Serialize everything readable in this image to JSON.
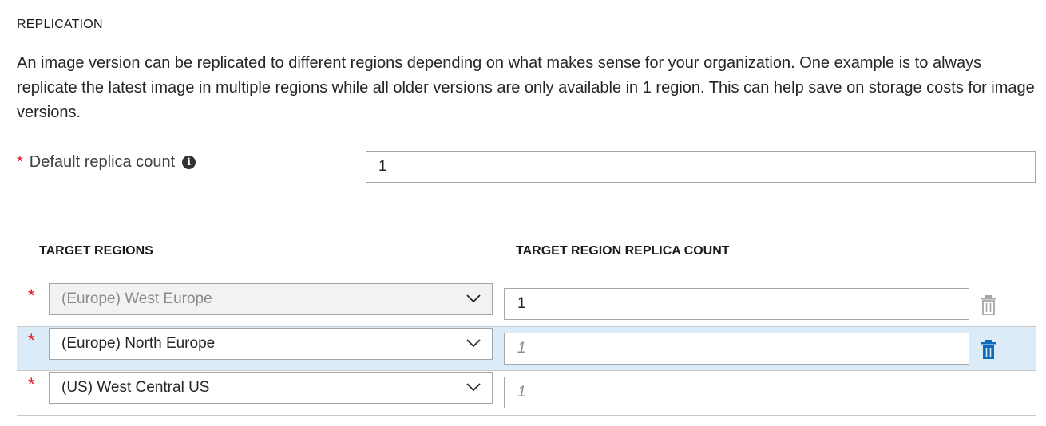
{
  "section": {
    "title": "REPLICATION",
    "description": "An image version can be replicated to different regions depending on what makes sense for your organization. One example is to always replicate the latest image in multiple regions while all older versions are only available in 1 region. This can help save on storage costs for image versions."
  },
  "default_replica": {
    "required_marker": "*",
    "label": "Default replica count",
    "info_icon": "info-icon",
    "value": "1"
  },
  "table": {
    "headers": {
      "regions": "TARGET REGIONS",
      "count": "TARGET REGION REPLICA COUNT"
    },
    "rows": [
      {
        "required_marker": "*",
        "region": "(Europe) West Europe",
        "region_disabled": true,
        "count_value": "1",
        "count_placeholder": "",
        "trash_icon": "trash-icon",
        "trash_state": "disabled"
      },
      {
        "required_marker": "*",
        "region": "(Europe) North Europe",
        "region_disabled": false,
        "count_value": "",
        "count_placeholder": "1",
        "trash_icon": "trash-icon",
        "trash_state": "active"
      },
      {
        "required_marker": "*",
        "region": "(US) West Central US",
        "region_disabled": false,
        "count_value": "",
        "count_placeholder": "1",
        "trash_icon": "",
        "trash_state": "hidden"
      }
    ]
  },
  "colors": {
    "required": "#e00b1c",
    "selected_row": "#dcebf8",
    "trash_active": "#0f6cbd",
    "trash_disabled": "#a6a6a6"
  }
}
